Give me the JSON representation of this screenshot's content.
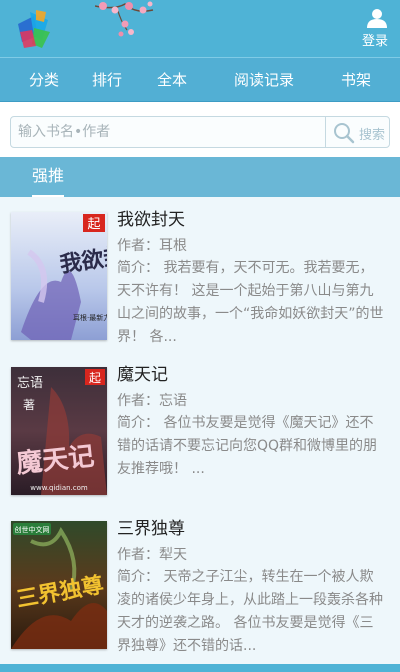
{
  "header": {
    "login_label": "登录",
    "logo_icon": "site-logo-icon",
    "login_icon": "user-icon",
    "colors": {
      "header_bg": "#4fb3d6",
      "nav_bg": "#52afd4",
      "section_bg": "#6ab7d6",
      "list_bg": "#eef7fb"
    }
  },
  "nav": {
    "items": [
      {
        "label": "分类"
      },
      {
        "label": "排行"
      },
      {
        "label": "全本"
      },
      {
        "label": "阅读记录"
      },
      {
        "label": "书架"
      }
    ]
  },
  "search": {
    "placeholder": "输入书名•作者",
    "button_label": "搜索",
    "button_icon": "search-icon"
  },
  "section": {
    "title": "强推"
  },
  "books": [
    {
      "title": "我欲封天",
      "author": "作者：耳根",
      "desc": "简介：  我若要有，天不可无。我若要无，天不许有！ 这是一个起始于第八山与第九山之间的故事，一个“我命如妖欲封天”的世界！ 各...",
      "cover_text": "我欲封天",
      "cover_badge": "起",
      "cover_sub": "耳根·最新力作",
      "cover_author": "耳根"
    },
    {
      "title": "魔天记",
      "author": "作者：忘语",
      "desc": "简介：  各位书友要是觉得《魔天记》还不错的话请不要忘记向您QQ群和微博里的朋友推荐哦！ ...",
      "cover_text": "魔天记",
      "cover_badge": "起",
      "cover_author": "忘语",
      "cover_zhu": "著",
      "cover_url": "www.qidian.com"
    },
    {
      "title": "三界独尊",
      "author": "作者：犁天",
      "desc": "简介：  天帝之子江尘，转生在一个被人欺凌的诸侯少年身上，从此踏上一段轰杀各种天才的逆袭之路。 各位书友要是觉得《三界独尊》还不错的话...",
      "cover_text": "三界独尊",
      "cover_badge": "创世中文网"
    }
  ]
}
